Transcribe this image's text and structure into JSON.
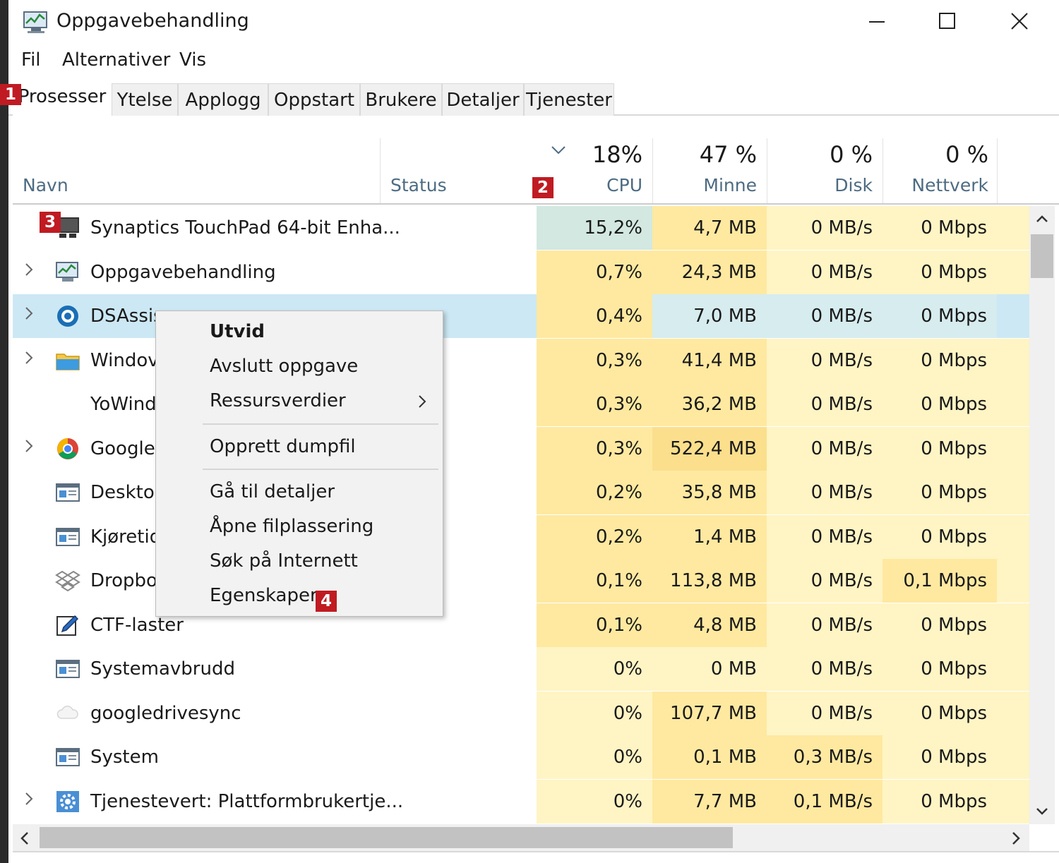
{
  "window": {
    "title": "Oppgavebehandling",
    "controls": [
      "–",
      "☐",
      "✕"
    ]
  },
  "menu": [
    "Fil",
    "Alternativer",
    "Vis"
  ],
  "tabs": [
    {
      "label": "Prosesser",
      "active": true
    },
    {
      "label": "Ytelse"
    },
    {
      "label": "Applogg"
    },
    {
      "label": "Oppstart"
    },
    {
      "label": "Brukere"
    },
    {
      "label": "Detaljer"
    },
    {
      "label": "Tjenester"
    }
  ],
  "badges": [
    "1",
    "2",
    "3",
    "4"
  ],
  "header": {
    "name": "Navn",
    "status": "Status",
    "cpu_pct": "18%",
    "cpu": "CPU",
    "mem_pct": "47 %",
    "mem": "Minne",
    "disk_pct": "0 %",
    "disk": "Disk",
    "net_pct": "0 %",
    "net": "Nettverk"
  },
  "rows": [
    {
      "name": "Synaptics TouchPad 64-bit Enha...",
      "icon": "touchpad-icon",
      "expand": false,
      "cpu": "15,2%",
      "mem": "4,7 MB",
      "disk": "0 MB/s",
      "net": "0 Mbps"
    },
    {
      "name": "Oppgavebehandling",
      "icon": "task-manager-icon",
      "expand": true,
      "cpu": "0,7%",
      "mem": "24,3 MB",
      "disk": "0 MB/s",
      "net": "0 Mbps"
    },
    {
      "name": "DSAssis",
      "icon": "dsassistant-icon",
      "expand": true,
      "selected": true,
      "cpu": "0,4%",
      "mem": "7,0 MB",
      "disk": "0 MB/s",
      "net": "0 Mbps"
    },
    {
      "name": "Windov",
      "icon": "explorer-folder-icon",
      "expand": true,
      "cpu": "0,3%",
      "mem": "41,4 MB",
      "disk": "0 MB/s",
      "net": "0 Mbps"
    },
    {
      "name": "YoWind",
      "icon": "",
      "expand": false,
      "cpu": "0,3%",
      "mem": "36,2 MB",
      "disk": "0 MB/s",
      "net": "0 Mbps"
    },
    {
      "name": "Google",
      "icon": "chrome-icon",
      "expand": true,
      "cpu": "0,3%",
      "mem": "522,4 MB",
      "disk": "0 MB/s",
      "net": "0 Mbps"
    },
    {
      "name": "Desktop",
      "icon": "app-window-icon",
      "expand": false,
      "cpu": "0,2%",
      "mem": "35,8 MB",
      "disk": "0 MB/s",
      "net": "0 Mbps"
    },
    {
      "name": "Kjøretid",
      "icon": "app-window-icon",
      "expand": false,
      "cpu": "0,2%",
      "mem": "1,4 MB",
      "disk": "0 MB/s",
      "net": "0 Mbps"
    },
    {
      "name": "Dropbo",
      "icon": "dropbox-icon",
      "expand": false,
      "cpu": "0,1%",
      "mem": "113,8 MB",
      "disk": "0 MB/s",
      "net": "0,1 Mbps"
    },
    {
      "name": "CTF-laster",
      "icon": "pen-edit-icon",
      "expand": false,
      "cpu": "0,1%",
      "mem": "4,8 MB",
      "disk": "0 MB/s",
      "net": "0 Mbps"
    },
    {
      "name": "Systemavbrudd",
      "icon": "app-window-icon",
      "expand": false,
      "cpu": "0%",
      "mem": "0 MB",
      "disk": "0 MB/s",
      "net": "0 Mbps"
    },
    {
      "name": "googledrivesync",
      "icon": "cloud-icon",
      "expand": false,
      "cpu": "0%",
      "mem": "107,7 MB",
      "disk": "0 MB/s",
      "net": "0 Mbps"
    },
    {
      "name": "System",
      "icon": "app-window-icon",
      "expand": false,
      "cpu": "0%",
      "mem": "0,1 MB",
      "disk": "0,3 MB/s",
      "net": "0 Mbps"
    },
    {
      "name": "Tjenestevert: Plattformbrukertje...",
      "icon": "service-gear-icon",
      "expand": true,
      "cpu": "0%",
      "mem": "7,7 MB",
      "disk": "0,1 MB/s",
      "net": "0 Mbps"
    }
  ],
  "context_menu": [
    {
      "label": "Utvid",
      "bold": true
    },
    {
      "label": "Avslutt oppgave"
    },
    {
      "label": "Ressursverdier",
      "submenu": true
    },
    {
      "label": "Opprett dumpfil"
    },
    {
      "label": "Gå til detaljer"
    },
    {
      "label": "Åpne filplassering"
    },
    {
      "label": "Søk på Internett"
    },
    {
      "label": "Egenskaper"
    }
  ],
  "colors": {
    "heat_low": "#fff4c4",
    "heat_mid": "#ffe9a0",
    "heat_high": "#fbdf8c",
    "heat_cpu_hot": "#d2e8e0",
    "selected_row": "#cce8f4",
    "badge_red": "#c01b22",
    "header_label": "#4d6b82"
  }
}
